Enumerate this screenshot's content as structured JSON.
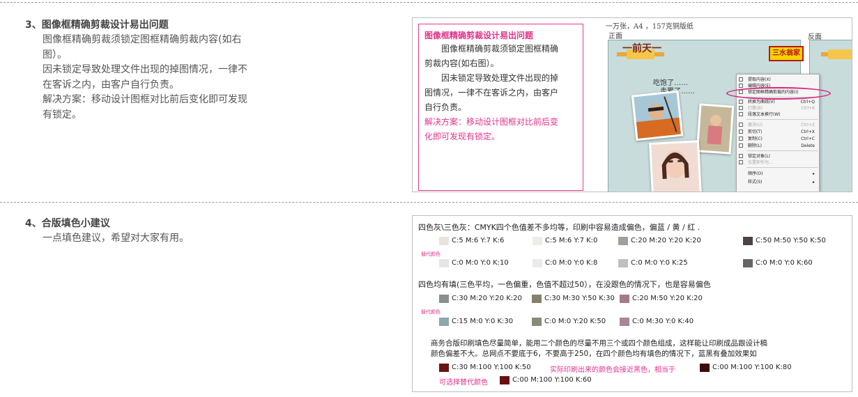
{
  "section3": {
    "title": "3、图像框精确剪裁设计易出问题",
    "lines": [
      "图像框精确剪裁须锁定图框精确剪裁内容(如右",
      "图）。",
      "因未锁定导致处理文件出现的掉图情况，一律不",
      "在客诉之内，由客户自行负责。",
      "解决方案：移动设计图框对比前后变化即可发现",
      "有锁定。"
    ],
    "illustration": {
      "title": "图像框精确剪裁设计易出问题",
      "lines": [
        "图像框精确剪裁须锁定图框精确",
        "剪裁内容(如右图）。",
        "因未锁定导致处理文件出现的掉",
        "图情况，一律不在客诉之内，由客户",
        "自行负责。"
      ],
      "solution_lines": [
        "解决方案：移动设计图框对比前后变",
        "化即可发现有锁定。"
      ],
      "caption": "一万张，A4 ，157克铜版纸",
      "front_label": "正面",
      "back_label": "反面",
      "banner_text": "一前天一",
      "brand_text": "三水翁家",
      "handwriting_1": "吃饱了……",
      "handwriting_2": "走累了……",
      "context_menu": [
        {
          "label": "提取内容(X)",
          "shortcut": "",
          "disabled": false
        },
        {
          "label": "编辑内容(E)",
          "shortcut": "",
          "disabled": false
        },
        {
          "label": "锁定图框精确剪裁的内容(I)",
          "shortcut": "",
          "disabled": false
        },
        {
          "label": "转换为曲线(V)",
          "shortcut": "Ctrl+Q",
          "disabled": false
        },
        {
          "label": "打散(B)",
          "shortcut": "Ctrl+K",
          "disabled": true
        },
        {
          "label": "段落文本换行(W)",
          "shortcut": "",
          "disabled": false
        },
        {
          "label": "撤消(U)",
          "shortcut": "Ctrl+Z",
          "disabled": true
        },
        {
          "label": "剪切(T)",
          "shortcut": "Ctrl+X",
          "disabled": false
        },
        {
          "label": "复制(C)",
          "shortcut": "Ctrl+C",
          "disabled": false
        },
        {
          "label": "删除(L)",
          "shortcut": "Delete",
          "disabled": false
        },
        {
          "label": "锁定对象(L)",
          "shortcut": "",
          "disabled": false
        },
        {
          "label": "位置即作为...",
          "shortcut": "",
          "disabled": true
        },
        {
          "label": "顺序(O)",
          "shortcut": "▸",
          "disabled": false
        },
        {
          "label": "样式(S)",
          "shortcut": "▸",
          "disabled": false
        }
      ]
    }
  },
  "section4": {
    "title": "4、合版填色小建议",
    "text": "一点填色建议，希望对大家有用。",
    "illustration": {
      "intro1": "四色灰\\三色灰：CMYK四个色值差不多均等，印刷中容易造成偏色，偏蓝 / 黄 / 红 .",
      "row1": [
        {
          "label": "C:5 M:6 Y:7 K:6",
          "color": "#e8e3de"
        },
        {
          "label": "C:5 M:6 Y:7 K:0",
          "color": "#f0ebe6"
        },
        {
          "label": "C:20 M:20 Y:20 K:20",
          "color": "#a49e99"
        },
        {
          "label": "C:50 M:50 Y:50 K:50",
          "color": "#4a4542"
        }
      ],
      "alt_label_1": "替代颜色",
      "row2": [
        {
          "label": "C:0 M:0 Y:0 K:10",
          "color": "#e6e6e6"
        },
        {
          "label": "C:0 M:0 Y:0 K:8",
          "color": "#ebebeb"
        },
        {
          "label": "C:0 M:0 Y:0 K:25",
          "color": "#bfbfbf"
        },
        {
          "label": "C:0 M:0 Y:0 K:60",
          "color": "#666666"
        }
      ],
      "intro2": "四色均有填(三色平均，一色偏重，色值不超过50），在没跟色的情况下，也是容易偏色",
      "row3": [
        {
          "label": "C:30 M:20 Y:20 K:20",
          "color": "#8a8f93"
        },
        {
          "label": "C:30 M:30 Y:50 K:30",
          "color": "#84806a"
        },
        {
          "label": "C:20 M:50 Y:20 K:20",
          "color": "#a47a88"
        }
      ],
      "alt_label_2": "替代颜色",
      "row4": [
        {
          "label": "C:15 M:0 Y:0 K:30",
          "color": "#8fa6ae"
        },
        {
          "label": "C:0 M:0 Y:20 K:50",
          "color": "#8a8a77"
        },
        {
          "label": "C:0 M:30 Y:0 K:40",
          "color": "#a88599"
        }
      ],
      "para_line1": "商务合版印刷填色尽量简单，能用二个颜色的尽量不用三个或四个颜色组成，这样能让印刷成品跟设计稿",
      "para_line2": "颜色偏差不大。总网点不要底于6，不要高于250，在四个颜色均有填色的情况下，蓝黑有叠加效果如",
      "row5_left": {
        "label": "C:30 M:100 Y:100 K:50",
        "color": "#6a1616"
      },
      "row5_note": "实际印刷出来的颜色会接近黑色，相当于",
      "row5_right": {
        "label": "C:00 M:100 Y:100 K:80",
        "color": "#3d0a0a"
      },
      "row6_note": "可选择替代颜色",
      "row6": {
        "label": "C:00 M:100 Y:100 K:60",
        "color": "#6b1010"
      }
    }
  }
}
